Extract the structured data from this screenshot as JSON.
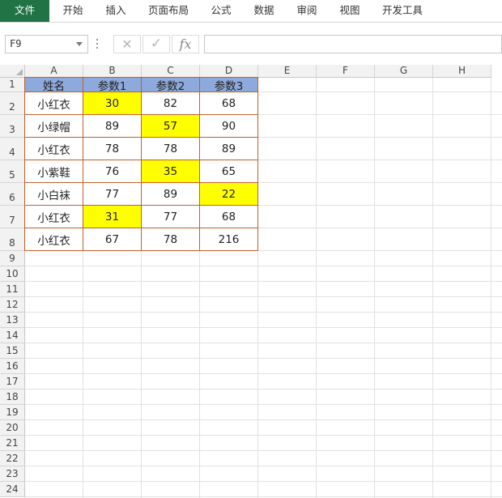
{
  "ribbon": {
    "tabs": [
      {
        "label": "文件",
        "active": true
      },
      {
        "label": "开始"
      },
      {
        "label": "插入"
      },
      {
        "label": "页面布局"
      },
      {
        "label": "公式"
      },
      {
        "label": "数据"
      },
      {
        "label": "审阅"
      },
      {
        "label": "视图"
      },
      {
        "label": "开发工具"
      }
    ],
    "active_color": "#217346"
  },
  "formula_bar": {
    "name_box": "F9",
    "cancel_icon": "✕",
    "enter_icon": "✓",
    "function_icon": "fx",
    "formula": ""
  },
  "grid": {
    "columns": [
      "A",
      "B",
      "C",
      "D",
      "E",
      "F",
      "G",
      "H"
    ],
    "rows": [
      "1",
      "2",
      "3",
      "4",
      "5",
      "6",
      "7",
      "8",
      "9",
      "10",
      "11",
      "12",
      "13",
      "14",
      "15",
      "16",
      "17",
      "18",
      "19",
      "20",
      "21",
      "22",
      "23",
      "24"
    ],
    "header_fill": "#8ea9db",
    "highlight_fill": "#ffff00",
    "border_color": "#c0602a"
  },
  "table": {
    "headers": [
      "姓名",
      "参数1",
      "参数2",
      "参数3"
    ],
    "rows": [
      [
        "小红衣",
        "30",
        "82",
        "68"
      ],
      [
        "小绿帽",
        "89",
        "57",
        "90"
      ],
      [
        "小红衣",
        "78",
        "78",
        "89"
      ],
      [
        "小紫鞋",
        "76",
        "35",
        "65"
      ],
      [
        "小白袜",
        "77",
        "89",
        "22"
      ],
      [
        "小红衣",
        "31",
        "77",
        "68"
      ],
      [
        "小红衣",
        "67",
        "78",
        "216"
      ]
    ],
    "highlighted": [
      [
        0,
        1
      ],
      [
        1,
        2
      ],
      [
        3,
        2
      ],
      [
        4,
        3
      ],
      [
        5,
        1
      ]
    ]
  }
}
